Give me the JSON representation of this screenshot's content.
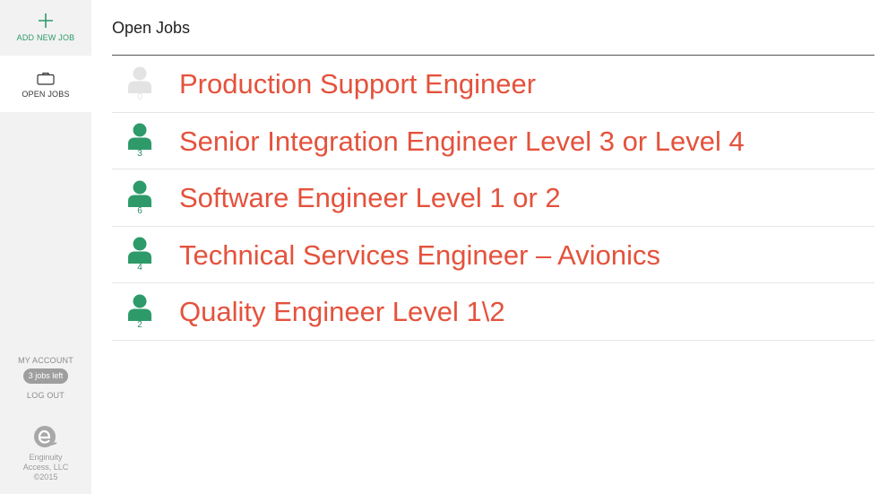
{
  "sidebar": {
    "add_job": {
      "label": "ADD NEW JOB",
      "icon": "plus-icon",
      "color": "#2e9a6a"
    },
    "open_jobs": {
      "label": "OPEN JOBS",
      "icon": "briefcase-icon"
    },
    "account": {
      "my_account": "MY ACCOUNT",
      "jobs_left": "3 jobs left",
      "logout": "LOG OUT"
    },
    "brand": {
      "logo": "enginuity-e-logo",
      "line1": "Enginuity",
      "line2": "Access, LLC",
      "line3": "©2015"
    }
  },
  "main": {
    "title": "Open Jobs",
    "jobs": [
      {
        "title": "Production Support Engineer",
        "applicants": "0",
        "active": false
      },
      {
        "title": "Senior Integration Engineer Level 3 or Level 4",
        "applicants": "3",
        "active": true
      },
      {
        "title": "Software Engineer Level 1 or 2",
        "applicants": "6",
        "active": true
      },
      {
        "title": "Technical Services Engineer – Avionics",
        "applicants": "4",
        "active": true
      },
      {
        "title": "Quality Engineer Level 1\\2",
        "applicants": "2",
        "active": true
      }
    ]
  },
  "colors": {
    "accent_green": "#2e9a6a",
    "title_red": "#e4523c",
    "inactive_gray": "#e3e3e3"
  }
}
